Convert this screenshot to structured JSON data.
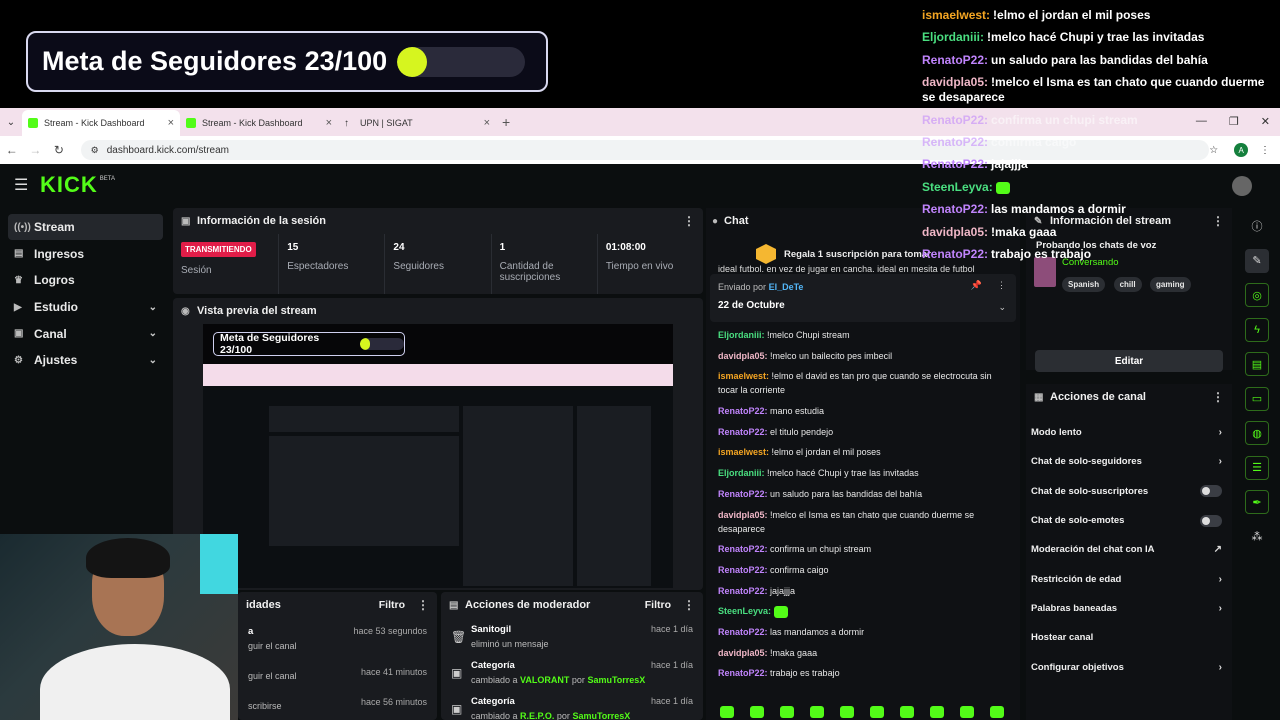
{
  "goal": {
    "text": "Meta de Seguidores 23/100",
    "progress": 0.23,
    "bar_color": "#d6f51f"
  },
  "overlay_chat": [
    {
      "user": "ismaelwest:",
      "msg": "!elmo el jordan el mil poses",
      "color": "#f5a623",
      "faded": false
    },
    {
      "user": "Eljordaniii:",
      "msg": "!melco hacé Chupi y trae las invitadas",
      "color": "#4ade80",
      "faded": false
    },
    {
      "user": "RenatoP22:",
      "msg": "un saludo para las bandidas del bahía",
      "color": "#c084fc",
      "faded": false
    },
    {
      "user": "davidpla05:",
      "msg": "!melco el Isma es tan chato que cuando duerme se desaparece",
      "color": "#f0b7c7",
      "faded": false
    },
    {
      "user": "RenatoP22:",
      "msg": "confirma un chupi stream",
      "color": "#c084fc",
      "faded": true
    },
    {
      "user": "RenatoP22:",
      "msg": "confirma caigo",
      "color": "#c084fc",
      "faded": true
    },
    {
      "user": "RenatoP22:",
      "msg": "jajajjja",
      "color": "#c084fc",
      "faded": false
    },
    {
      "user": "SteenLeyva:",
      "msg": "",
      "color": "#4ade80",
      "faded": false,
      "emote": true
    },
    {
      "user": "RenatoP22:",
      "msg": "las mandamos a dormir",
      "color": "#c084fc",
      "faded": false
    },
    {
      "user": "davidpla05:",
      "msg": "!maka gaaa",
      "color": "#f0b7c7",
      "faded": false
    },
    {
      "user": "RenatoP22:",
      "msg": "trabajo es trabajo",
      "color": "#c084fc",
      "faded": false
    }
  ],
  "browser": {
    "tabs": [
      {
        "title": "Stream - Kick Dashboard",
        "active": true
      },
      {
        "title": "Stream - Kick Dashboard",
        "active": false
      },
      {
        "title": "UPN | SIGAT",
        "active": false
      }
    ],
    "url": "dashboard.kick.com/stream",
    "profile_initial": "A"
  },
  "app": {
    "logo": "KICK",
    "beta": "BETA",
    "sidebar": [
      {
        "label": "Stream",
        "active": true,
        "chevron": false
      },
      {
        "label": "Ingresos",
        "active": false,
        "chevron": false
      },
      {
        "label": "Logros",
        "active": false,
        "chevron": false
      },
      {
        "label": "Estudio",
        "active": false,
        "chevron": true
      },
      {
        "label": "Canal",
        "active": false,
        "chevron": true
      },
      {
        "label": "Ajustes",
        "active": false,
        "chevron": true
      }
    ],
    "session": {
      "title": "Información de la sesión",
      "badge": "TRANSMITIENDO",
      "session_label": "Sesión",
      "stats": [
        {
          "value": "15",
          "label": "Espectadores"
        },
        {
          "value": "24",
          "label": "Seguidores"
        },
        {
          "value": "1",
          "label": "Cantidad de suscripciones"
        },
        {
          "value": "01:08:00",
          "label": "Tiempo en vivo"
        }
      ]
    },
    "preview": {
      "title": "Vista previa del stream",
      "mini_goal": "Meta de Seguidores 23/100"
    },
    "activity": {
      "title": "idades",
      "filter": "Filtro",
      "rows": [
        {
          "title": "a",
          "sub": "guir el canal",
          "time": "hace 53 segundos"
        },
        {
          "title": "",
          "sub": "guir el canal",
          "time": "hace 41 minutos"
        },
        {
          "title": "",
          "sub": "scribirse",
          "time": "hace 56 minutos"
        }
      ]
    },
    "mod_actions": {
      "title": "Acciones de moderador",
      "filter": "Filtro",
      "rows": [
        {
          "title": "Sanitogil",
          "sub_pre": "eliminó un mensaje",
          "hl": "",
          "sub_mid": "",
          "hl2": "",
          "time": "hace 1 día",
          "icon": "trash-icon"
        },
        {
          "title": "Categoría",
          "sub_pre": "cambiado a",
          "hl": "VALORANT",
          "sub_mid": "por",
          "hl2": "SamuTorresX",
          "time": "hace 1 día",
          "icon": "category-icon"
        },
        {
          "title": "Categoría",
          "sub_pre": "cambiado a",
          "hl": "R.E.P.O.",
          "sub_mid": "por",
          "hl2": "SamuTorresX",
          "time": "hace 1 día",
          "icon": "category-icon"
        }
      ]
    },
    "chat": {
      "title": "Chat",
      "gift_text": "Regala 1 suscripción para tomar",
      "gift_count": "1",
      "pinned_top": "ideal futbol. en vez de jugar en cancha. ideal en mesita de futbol",
      "pinned_by_label": "Enviado por",
      "pinned_by": "El_DeTe",
      "pinned_date": "22 de Octubre",
      "messages": [
        {
          "user": "Eljordaniii:",
          "msg": "!melco Chupi stream",
          "color": "#4ade80"
        },
        {
          "user": "davidpla05:",
          "msg": "!melco un bailecito pes imbecil",
          "color": "#f0b7c7"
        },
        {
          "user": "ismaelwest:",
          "msg": "!elmo el david es tan pro que cuando se electrocuta sin tocar la corriente",
          "color": "#f5a623"
        },
        {
          "user": "RenatoP22:",
          "msg": "mano estudia",
          "color": "#c084fc"
        },
        {
          "user": "RenatoP22:",
          "msg": "el titulo pendejo",
          "color": "#c084fc"
        },
        {
          "user": "ismaelwest:",
          "msg": "!elmo el jordan el mil poses",
          "color": "#f5a623"
        },
        {
          "user": "Eljordaniii:",
          "msg": "!melco hacé Chupi y trae las invitadas",
          "color": "#4ade80"
        },
        {
          "user": "RenatoP22:",
          "msg": "un saludo para las bandidas del bahía",
          "color": "#c084fc"
        },
        {
          "user": "davidpla05:",
          "msg": "!melco el Isma es tan chato que cuando duerme se desaparece",
          "color": "#f0b7c7"
        },
        {
          "user": "RenatoP22:",
          "msg": "confirma un chupi stream",
          "color": "#c084fc"
        },
        {
          "user": "RenatoP22:",
          "msg": "confirma caigo",
          "color": "#c084fc"
        },
        {
          "user": "RenatoP22:",
          "msg": "jajajjja",
          "color": "#c084fc"
        },
        {
          "user": "SteenLeyva:",
          "msg": "",
          "color": "#4ade80",
          "emote": true
        },
        {
          "user": "RenatoP22:",
          "msg": "las mandamos a dormir",
          "color": "#c084fc"
        },
        {
          "user": "davidpla05:",
          "msg": "!maka gaaa",
          "color": "#f0b7c7"
        },
        {
          "user": "RenatoP22:",
          "msg": "trabajo es trabajo",
          "color": "#c084fc"
        }
      ]
    },
    "stream_info": {
      "title": "Información del stream",
      "stream_title": "Probando los chats de voz",
      "category": "Conversando",
      "tags": [
        "Spanish",
        "chill",
        "gaming"
      ],
      "edit": "Editar"
    },
    "channel_actions": {
      "title": "Acciones de canal",
      "rows": [
        {
          "label": "Modo lento",
          "control": "chevron"
        },
        {
          "label": "Chat de solo-seguidores",
          "control": "chevron"
        },
        {
          "label": "Chat de solo-suscriptores",
          "control": "toggle"
        },
        {
          "label": "Chat de solo-emotes",
          "control": "toggle"
        },
        {
          "label": "Moderación del chat con IA",
          "control": "external"
        },
        {
          "label": "Restricción de edad",
          "control": "chevron"
        },
        {
          "label": "Palabras baneadas",
          "control": "chevron"
        },
        {
          "label": "Hostear canal",
          "control": "none"
        },
        {
          "label": "Configurar objetivos",
          "control": "chevron"
        }
      ]
    }
  }
}
